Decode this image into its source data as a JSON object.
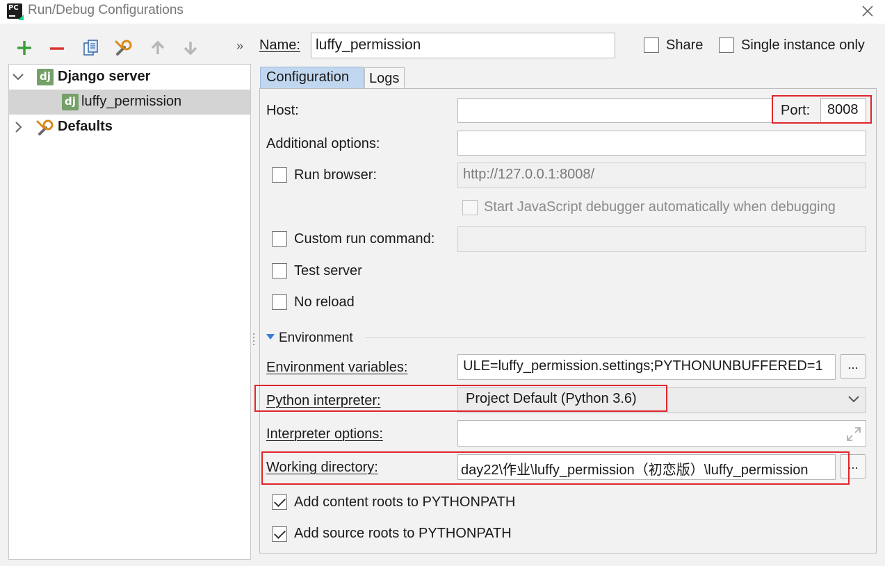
{
  "window": {
    "title": "Run/Debug Configurations",
    "app_icon_text": "PC"
  },
  "toolbar": {
    "add": "add-icon",
    "remove": "remove-icon",
    "copy": "copy-icon",
    "edit_defaults": "wrench-icon",
    "move_up": "arrow-up-icon",
    "move_down": "arrow-down-icon",
    "expand": "»"
  },
  "tree": {
    "group_label": "Django server",
    "item_label": "luffy_permission",
    "defaults_label": "Defaults",
    "icon_text": "dj"
  },
  "form": {
    "name_label": "Name:",
    "name_value": "luffy_permission",
    "share_label": "Share",
    "single_instance_label": "Single instance only",
    "tabs": [
      "Configuration",
      "Logs"
    ],
    "host_label": "Host:",
    "host_value": "",
    "port_label": "Port:",
    "port_value": "8008",
    "additional_options_label": "Additional options:",
    "additional_options_value": "",
    "run_browser_label": "Run browser:",
    "run_browser_url": "http://127.0.0.1:8008/",
    "js_debugger_label": "Start JavaScript debugger automatically when debugging",
    "custom_run_label": "Custom run command:",
    "custom_run_value": "",
    "test_server_label": "Test server",
    "no_reload_label": "No reload",
    "environment_header": "Environment",
    "env_vars_label": "Environment variables:",
    "env_vars_value": "ULE=luffy_permission.settings;PYTHONUNBUFFERED=1",
    "interpreter_label": "Python interpreter:",
    "interpreter_value": "Project Default (Python 3.6)",
    "interpreter_options_label": "Interpreter options:",
    "interpreter_options_value": "",
    "working_dir_label": "Working directory:",
    "working_dir_value": "day22\\作业\\luffy_permission（初恋版）\\luffy_permission",
    "browse_label": "...",
    "content_roots_label": "Add content roots to PYTHONPATH",
    "source_roots_label": "Add source roots to PYTHONPATH"
  },
  "colors": {
    "highlight_box": "#e0262b",
    "django_green": "#75a068",
    "tab_active": "#c1d7ef"
  }
}
